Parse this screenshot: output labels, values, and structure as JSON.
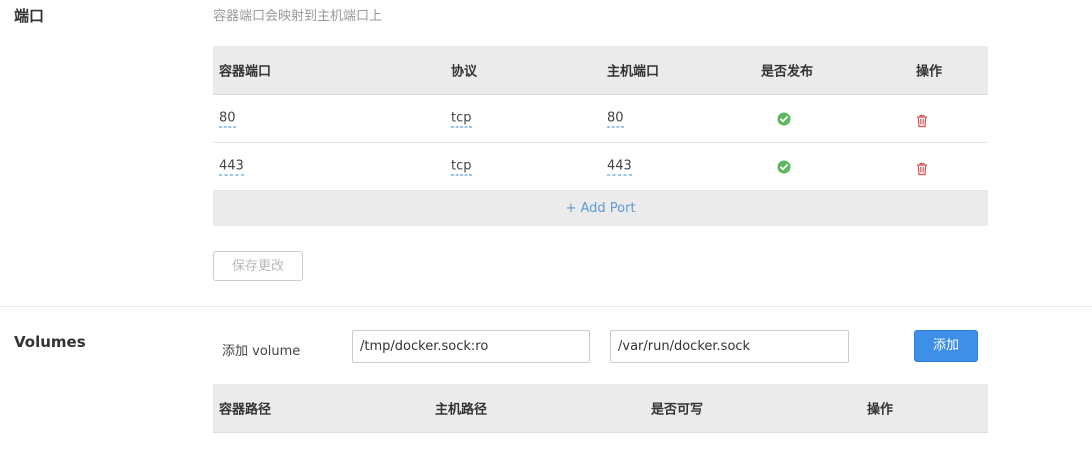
{
  "ports": {
    "title": "端口",
    "hint": "容器端口会映射到主机端口上",
    "columns": [
      "容器端口",
      "协议",
      "主机端口",
      "是否发布",
      "操作"
    ],
    "rows": [
      {
        "container_port": "80",
        "protocol": "tcp",
        "host_port": "80",
        "published": true
      },
      {
        "container_port": "443",
        "protocol": "tcp",
        "host_port": "443",
        "published": true
      }
    ],
    "add_port_label": "+ Add Port",
    "save_label": "保存更改"
  },
  "volumes": {
    "title": "Volumes",
    "add_label": "添加 volume",
    "container_path_value": "/tmp/docker.sock:ro",
    "host_path_value": "/var/run/docker.sock",
    "add_button_label": "添加",
    "columns": [
      "容器路径",
      "主机路径",
      "是否可写",
      "操作"
    ]
  },
  "colors": {
    "check": "#5cb85c",
    "trash": "#d9534f",
    "link": "#5b9bd5",
    "primary": "#3d8fe8"
  },
  "icons": {
    "published": "check-circle-icon",
    "delete": "trash-icon"
  }
}
